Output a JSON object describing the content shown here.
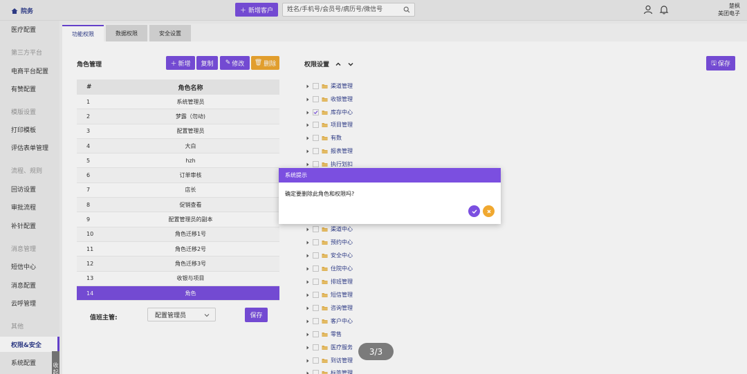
{
  "header": {
    "home_label": "院务",
    "new_customer_label": "新增客户",
    "search_placeholder": "姓名/手机号/会员号/病历号/微信号",
    "user_name": "楚枫",
    "company": "美团电子"
  },
  "sidebar": {
    "items": [
      {
        "label": "医疗配置",
        "kind": "item"
      },
      {
        "label": "第三方平台",
        "kind": "group"
      },
      {
        "label": "电商平台配置",
        "kind": "item"
      },
      {
        "label": "有赞配置",
        "kind": "item"
      },
      {
        "label": "模版设置",
        "kind": "group"
      },
      {
        "label": "打印模板",
        "kind": "item"
      },
      {
        "label": "评估表单管理",
        "kind": "item"
      },
      {
        "label": "流程、规则",
        "kind": "group"
      },
      {
        "label": "回访设置",
        "kind": "item"
      },
      {
        "label": "审批流程",
        "kind": "item"
      },
      {
        "label": "补针配置",
        "kind": "item"
      },
      {
        "label": "消息管理",
        "kind": "group"
      },
      {
        "label": "短信中心",
        "kind": "item"
      },
      {
        "label": "消息配置",
        "kind": "item"
      },
      {
        "label": "云呼管理",
        "kind": "item"
      },
      {
        "label": "其他",
        "kind": "group"
      },
      {
        "label": "权限&安全",
        "kind": "active"
      },
      {
        "label": "系统配置",
        "kind": "item"
      }
    ],
    "collapse_label": "收起"
  },
  "tabs": [
    {
      "label": "功能权限",
      "active": true
    },
    {
      "label": "数据权限",
      "active": false
    },
    {
      "label": "安全设置",
      "active": false
    }
  ],
  "role_panel": {
    "title": "角色管理",
    "buttons": {
      "add": "新增",
      "copy": "复制",
      "edit": "修改",
      "delete": "删除"
    },
    "columns": [
      "#",
      "角色名称"
    ],
    "rows": [
      {
        "num": "1",
        "name": "系统管理员"
      },
      {
        "num": "2",
        "name": "梦露（勿动)"
      },
      {
        "num": "3",
        "name": "配置管理员"
      },
      {
        "num": "4",
        "name": "大白"
      },
      {
        "num": "5",
        "name": "hzh"
      },
      {
        "num": "6",
        "name": "订单审核"
      },
      {
        "num": "7",
        "name": "店长"
      },
      {
        "num": "8",
        "name": "促销查看"
      },
      {
        "num": "9",
        "name": "配置管理员的副本"
      },
      {
        "num": "10",
        "name": "角色迁移1号"
      },
      {
        "num": "11",
        "name": "角色迁移2号"
      },
      {
        "num": "12",
        "name": "角色迁移3号"
      },
      {
        "num": "13",
        "name": "收银与项目"
      },
      {
        "num": "14",
        "name": "角色"
      }
    ],
    "selected_row": 13,
    "dept_label": "值班主管:",
    "dept_value": "配置管理员",
    "save_label": "保存"
  },
  "perm_panel": {
    "title": "权限设置",
    "save_label": "保存",
    "tree": [
      {
        "label": "渠道管理",
        "checked": false
      },
      {
        "label": "收银管理",
        "checked": false
      },
      {
        "label": "库存中心",
        "checked": true
      },
      {
        "label": "项目管理",
        "checked": false
      },
      {
        "label": "有数",
        "checked": false
      },
      {
        "label": "报表管理",
        "checked": false
      },
      {
        "label": "执行划扣",
        "checked": false
      },
      {
        "label": "渠道中心",
        "checked": false
      },
      {
        "label": "预约中心",
        "checked": false
      },
      {
        "label": "安全中心",
        "checked": false
      },
      {
        "label": "住院中心",
        "checked": false
      },
      {
        "label": "排班管理",
        "checked": false
      },
      {
        "label": "短信管理",
        "checked": false
      },
      {
        "label": "咨询管理",
        "checked": false
      },
      {
        "label": "客户中心",
        "checked": false
      },
      {
        "label": "零售",
        "checked": false
      },
      {
        "label": "医疗服务",
        "checked": false
      },
      {
        "label": "到访管理",
        "checked": false
      },
      {
        "label": "标签管理",
        "checked": false
      }
    ]
  },
  "dialog": {
    "title": "系统提示",
    "message": "确定要删除此角色和权限吗?"
  },
  "pager": "3/3",
  "colors": {
    "accent": "#7b4fe0",
    "warning": "#f0a830",
    "link": "#2f3d8c"
  }
}
